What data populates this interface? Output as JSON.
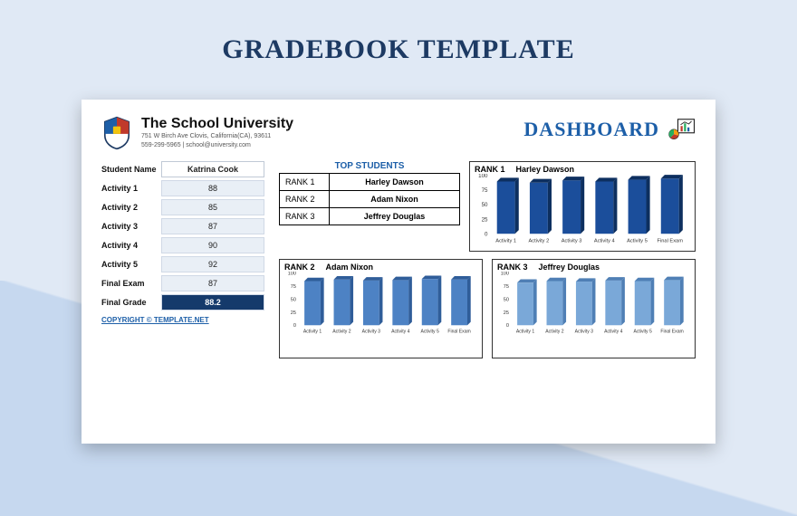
{
  "page_title": "GRADEBOOK TEMPLATE",
  "school": {
    "name": "The School University",
    "address": "751 W Birch Ave Clovis, California(CA), 93611",
    "contact": "559-299-5965 | school@university.com"
  },
  "dashboard_label": "DASHBOARD",
  "student": {
    "label": "Student Name",
    "name": "Katrina Cook",
    "rows": [
      {
        "label": "Activity 1",
        "value": "88"
      },
      {
        "label": "Activity 2",
        "value": "85"
      },
      {
        "label": "Activity 3",
        "value": "87"
      },
      {
        "label": "Activity 4",
        "value": "90"
      },
      {
        "label": "Activity 5",
        "value": "92"
      },
      {
        "label": "Final Exam",
        "value": "87"
      }
    ],
    "final_label": "Final Grade",
    "final_value": "88.2"
  },
  "copyright": "COPYRIGHT © TEMPLATE.NET",
  "top_students": {
    "title": "TOP STUDENTS",
    "ranks": [
      {
        "rank": "RANK 1",
        "name": "Harley Dawson"
      },
      {
        "rank": "RANK 2",
        "name": "Adam Nixon"
      },
      {
        "rank": "RANK 3",
        "name": "Jeffrey Douglas"
      }
    ]
  },
  "chart_data": [
    {
      "type": "bar",
      "rank": "RANK 1",
      "name": "Harley Dawson",
      "categories": [
        "Activity 1",
        "Activity 2",
        "Activity 3",
        "Activity 4",
        "Activity 5",
        "Final Exam"
      ],
      "values": [
        90,
        88,
        92,
        90,
        93,
        95
      ],
      "ylim": [
        0,
        100
      ],
      "ticks": [
        0,
        25,
        50,
        75,
        100
      ],
      "color": "#1b4e9b",
      "color_side": "#0d2f5f"
    },
    {
      "type": "bar",
      "rank": "RANK 2",
      "name": "Adam Nixon",
      "categories": [
        "Activity 1",
        "Activity 2",
        "Activity 3",
        "Activity 4",
        "Activity 5",
        "Final Exam"
      ],
      "values": [
        85,
        88,
        86,
        87,
        89,
        88
      ],
      "ylim": [
        0,
        100
      ],
      "ticks": [
        0,
        25,
        50,
        75,
        100
      ],
      "color": "#4d82c4",
      "color_side": "#2f5d99"
    },
    {
      "type": "bar",
      "rank": "RANK 3",
      "name": "Jeffrey Douglas",
      "categories": [
        "Activity 1",
        "Activity 2",
        "Activity 3",
        "Activity 4",
        "Activity 5",
        "Final Exam"
      ],
      "values": [
        82,
        85,
        84,
        86,
        85,
        87
      ],
      "ylim": [
        0,
        100
      ],
      "ticks": [
        0,
        25,
        50,
        75,
        100
      ],
      "color": "#7aa8d8",
      "color_side": "#4f7fb5"
    }
  ]
}
